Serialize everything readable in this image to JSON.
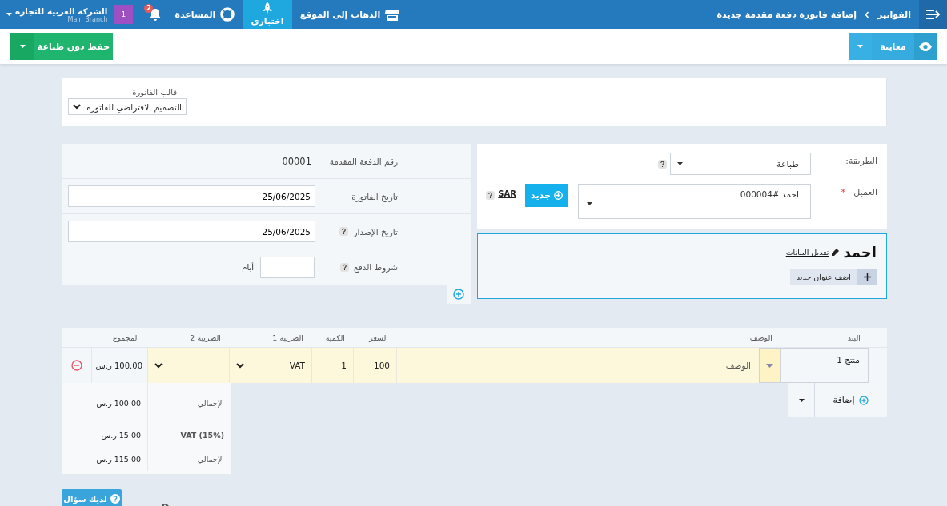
{
  "top_bar": {
    "breadcrumb": [
      "الفواتير",
      "إضافة فاتورة دفعة مقدمة جديدة"
    ],
    "links": [
      {
        "kind": "site",
        "label": "الذهاب إلى الموقع",
        "selected": false
      },
      {
        "kind": "test",
        "label": "اختباري",
        "selected": true
      },
      {
        "kind": "help",
        "label": "المساعدة",
        "selected": false
      }
    ],
    "notifications": "2",
    "user_badge": "1",
    "company": {
      "name": "الشركة العربية للتجارة",
      "branch": "Main Branch"
    }
  },
  "action_bar": {
    "preview_button": "معاينة",
    "save_button": "حفظ دون طباعة"
  },
  "template": {
    "label": "قالب الفاتورة",
    "value": "التصميم الافتراضي للفاتورة"
  },
  "details": [
    {
      "kind": "text",
      "label": "رقم الدفعة المقدمة",
      "value": "00001",
      "help": false
    },
    {
      "kind": "input",
      "label": "تاريخ الفاتورة",
      "value": "25/06/2025",
      "help": false
    },
    {
      "kind": "input",
      "label": "تاريخ الإصدار",
      "value": "25/06/2025",
      "help": true
    },
    {
      "kind": "days",
      "label": "شروط الدفع",
      "unit": "أيام",
      "help": true
    }
  ],
  "method": {
    "label": "الطريقة:",
    "value": "طباعة"
  },
  "client": {
    "label": "العميل",
    "required_mark": "*",
    "value": "احمد #000004",
    "new_button": "جديد",
    "currency": "SAR"
  },
  "client_card": {
    "name": "احمد",
    "edit_link": "تعديل البيانات",
    "add_address": "اضف عنوان جديد"
  },
  "items_table": {
    "columns": [
      "البند",
      "الوصف",
      "السعر",
      "الكمية",
      "الضريبة 1",
      "الضريبة 2",
      "المجموع"
    ],
    "rows": [
      {
        "item": "منتج 1",
        "description_placeholder": "الوصف",
        "price": "100",
        "quantity": "1",
        "tax_1": "VAT",
        "total": "100.00 ر.س"
      }
    ]
  },
  "add_item_button": "إضافة",
  "totals": [
    {
      "label": "الإجمالي",
      "value": "100.00 ر.س"
    },
    {
      "label": "VAT (15%)",
      "value": "15.00 ر.س"
    },
    {
      "label": "الإجمالي",
      "value": "115.00 ر.س"
    }
  ],
  "help_button": "لديك سؤال"
}
